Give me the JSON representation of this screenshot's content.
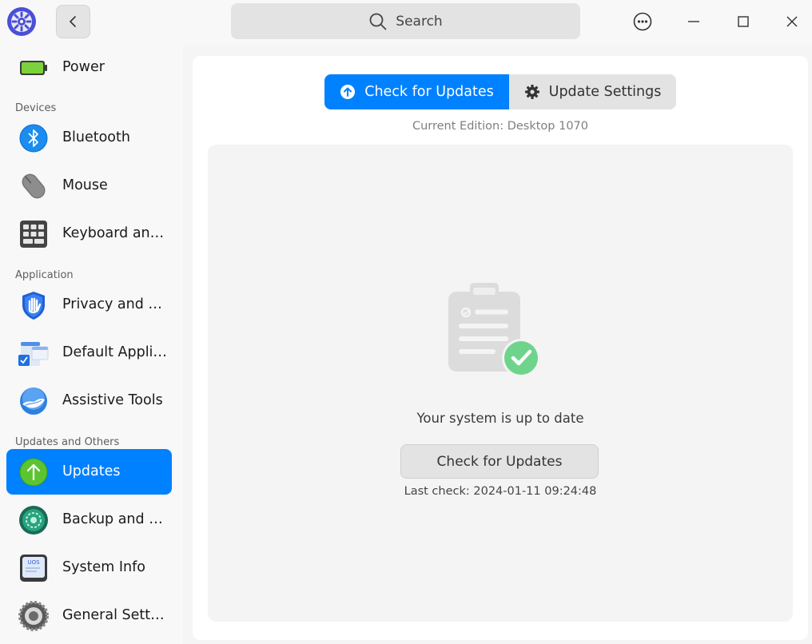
{
  "titlebar": {
    "search_placeholder": "Search"
  },
  "sidebar": {
    "items": [
      {
        "label": "Power",
        "icon": "battery-icon"
      },
      {
        "label": "Bluetooth",
        "icon": "bluetooth-icon"
      },
      {
        "label": "Mouse",
        "icon": "mouse-icon"
      },
      {
        "label": "Keyboard an…",
        "icon": "keyboard-icon"
      },
      {
        "label": "Privacy and …",
        "icon": "privacy-shield-icon"
      },
      {
        "label": "Default Appli…",
        "icon": "default-apps-icon"
      },
      {
        "label": "Assistive Tools",
        "icon": "assistive-tools-icon"
      },
      {
        "label": "Updates",
        "icon": "updates-arrow-icon"
      },
      {
        "label": "Backup and …",
        "icon": "backup-icon"
      },
      {
        "label": "System Info",
        "icon": "system-info-icon"
      },
      {
        "label": "General Sett…",
        "icon": "general-settings-gear-icon"
      }
    ],
    "groups": [
      "Devices",
      "Application",
      "Updates and Others"
    ],
    "active_item": "Updates"
  },
  "main": {
    "tabs": [
      {
        "label": "Check for Updates",
        "icon": "upload-circle-icon",
        "active": true
      },
      {
        "label": "Update Settings",
        "icon": "gear-icon",
        "active": false
      }
    ],
    "edition": "Current Edition: Desktop 1070",
    "status_text": "Your system is up to date",
    "check_button": "Check for Updates",
    "last_check": "Last check: 2024-01-11 09:24:48"
  },
  "colors": {
    "accent": "#0081ff",
    "success": "#6ed48b"
  }
}
